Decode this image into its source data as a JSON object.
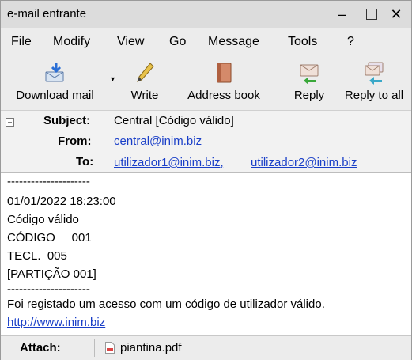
{
  "window": {
    "title": "e-mail entrante",
    "minimize_glyph": "–",
    "close_glyph": "✕"
  },
  "menu": [
    {
      "label": "File"
    },
    {
      "label": "Modify"
    },
    {
      "label": "View"
    },
    {
      "label": "Go"
    },
    {
      "label": "Message"
    },
    {
      "label": "Tools"
    },
    {
      "label": "?"
    }
  ],
  "toolbar": {
    "download_label": "Download mail",
    "write_label": "Write",
    "address_book_label": "Address book",
    "reply_label": "Reply",
    "reply_all_label": "Reply to all"
  },
  "header": {
    "subject_label": "Subject:",
    "subject_value": "Central [Código válido]",
    "from_label": "From:",
    "from_value": "central@inim.biz",
    "to_label": "To:",
    "to_values": [
      "utilizador1@inim.biz,",
      "utilizador2@inim.biz"
    ]
  },
  "body": {
    "lines": [
      "---------------------",
      "01/01/2022 18:23:00",
      "Código válido",
      "CÓDIGO     001",
      "TECL.  005",
      "[PARTIÇÃO 001]",
      "---------------------",
      "Foi registado um acesso com um código de utilizador válido."
    ],
    "link": "http://www.inim.biz"
  },
  "attachments": {
    "label": "Attach:",
    "file_name": "piantina.pdf"
  },
  "colors": {
    "link": "#1a3fc8",
    "titlebar": "#dcdcdc",
    "toolbar": "#ececec"
  }
}
